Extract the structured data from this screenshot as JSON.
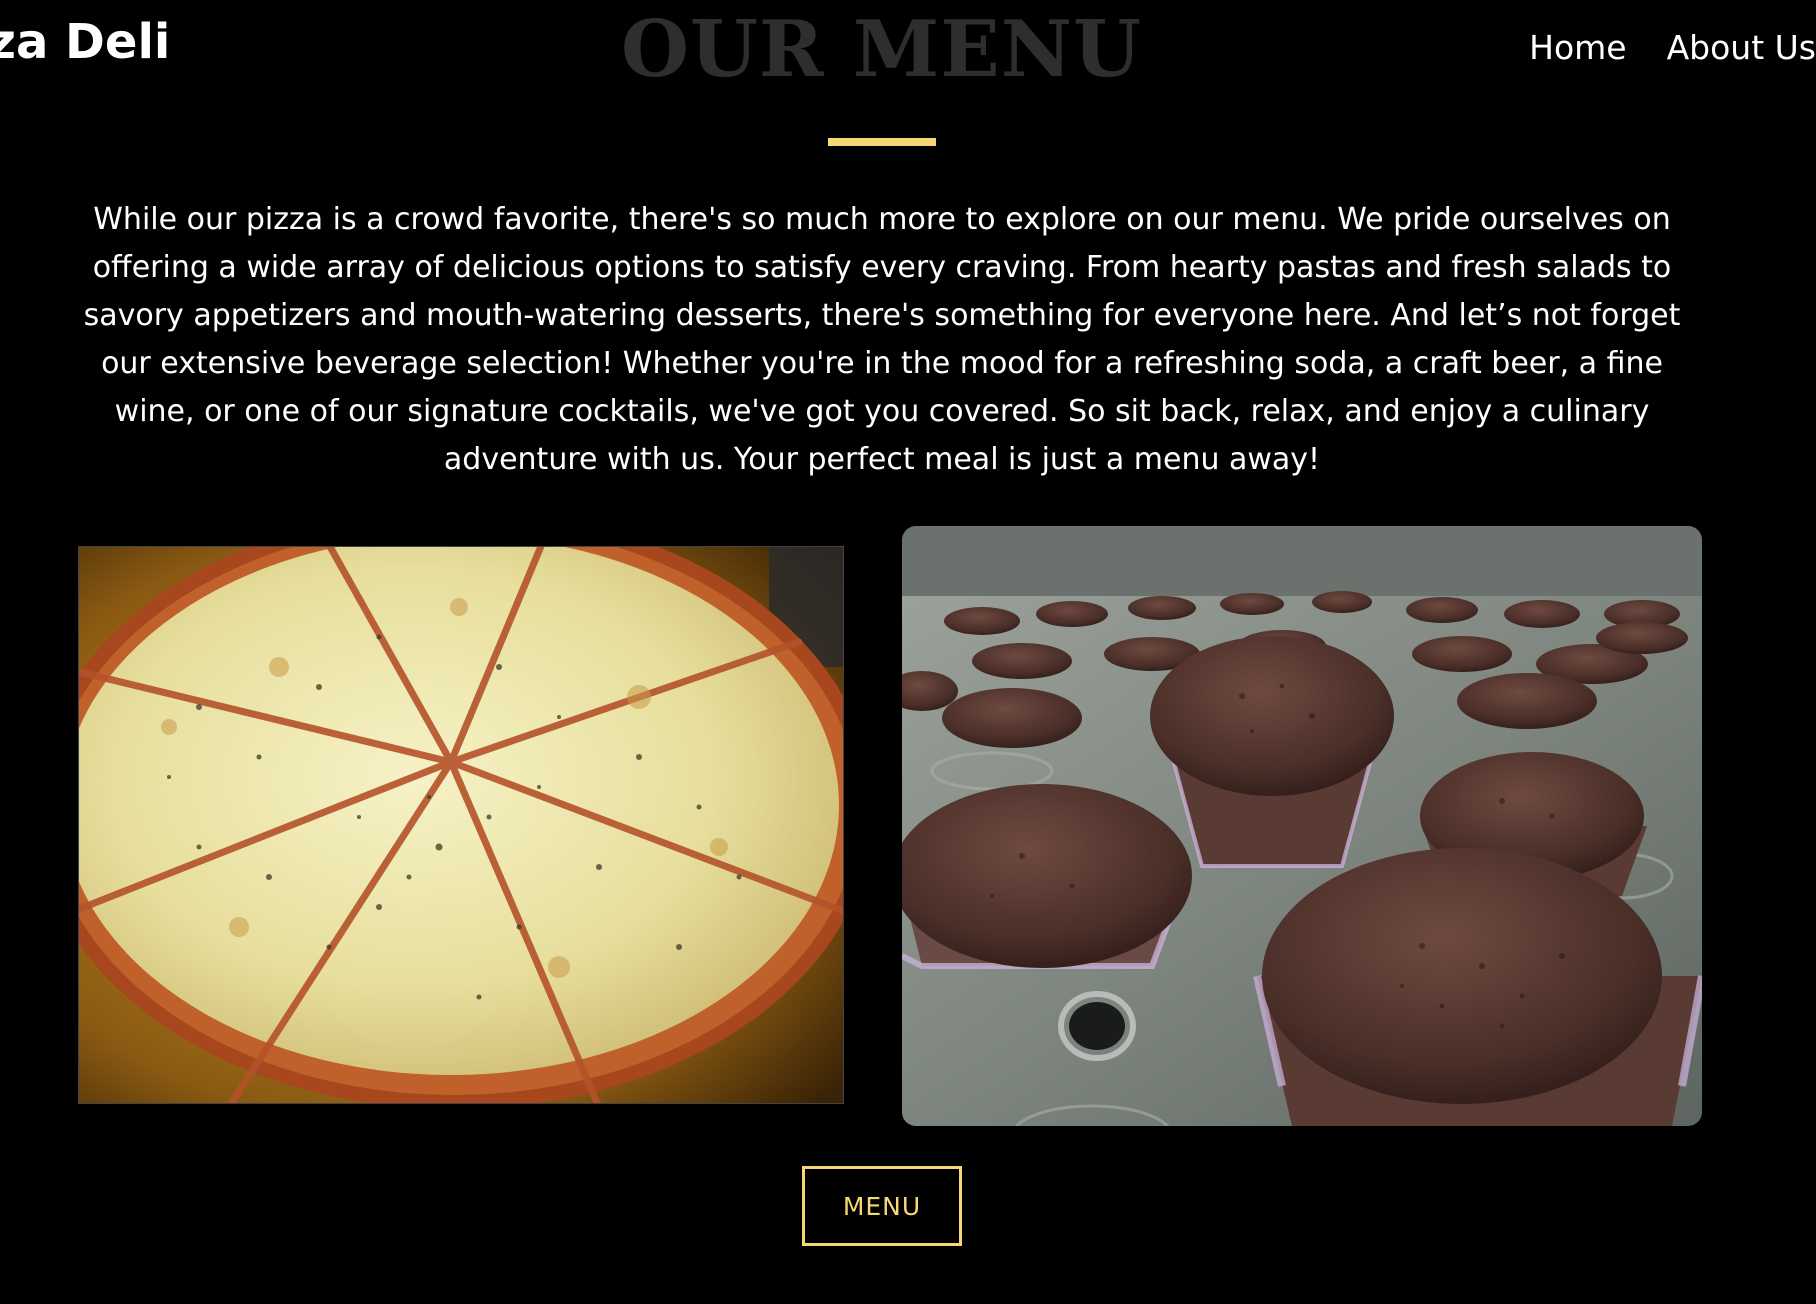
{
  "header": {
    "brand": "za Deli",
    "nav": {
      "home": "Home",
      "about": "About Us"
    }
  },
  "menu_section": {
    "title": "OUR MENU",
    "description": "While our pizza is a crowd favorite, there's so much more to explore on our menu. We pride ourselves on offering a wide array of delicious options to satisfy every craving. From hearty pastas and fresh salads to savory appetizers and mouth-watering desserts, there's something for everyone here. And let’s not forget our extensive beverage selection! Whether you're in the mood for a refreshing soda, a craft beer, a fine wine, or one of our signature cocktails, we've got you covered. So sit back, relax, and enjoy a culinary adventure with us. Your perfect meal is just a menu away!",
    "button_label": "MENU"
  },
  "colors": {
    "background": "#000000",
    "accent": "#f7d674",
    "title": "#2e2e2e",
    "text": "#ffffff"
  }
}
